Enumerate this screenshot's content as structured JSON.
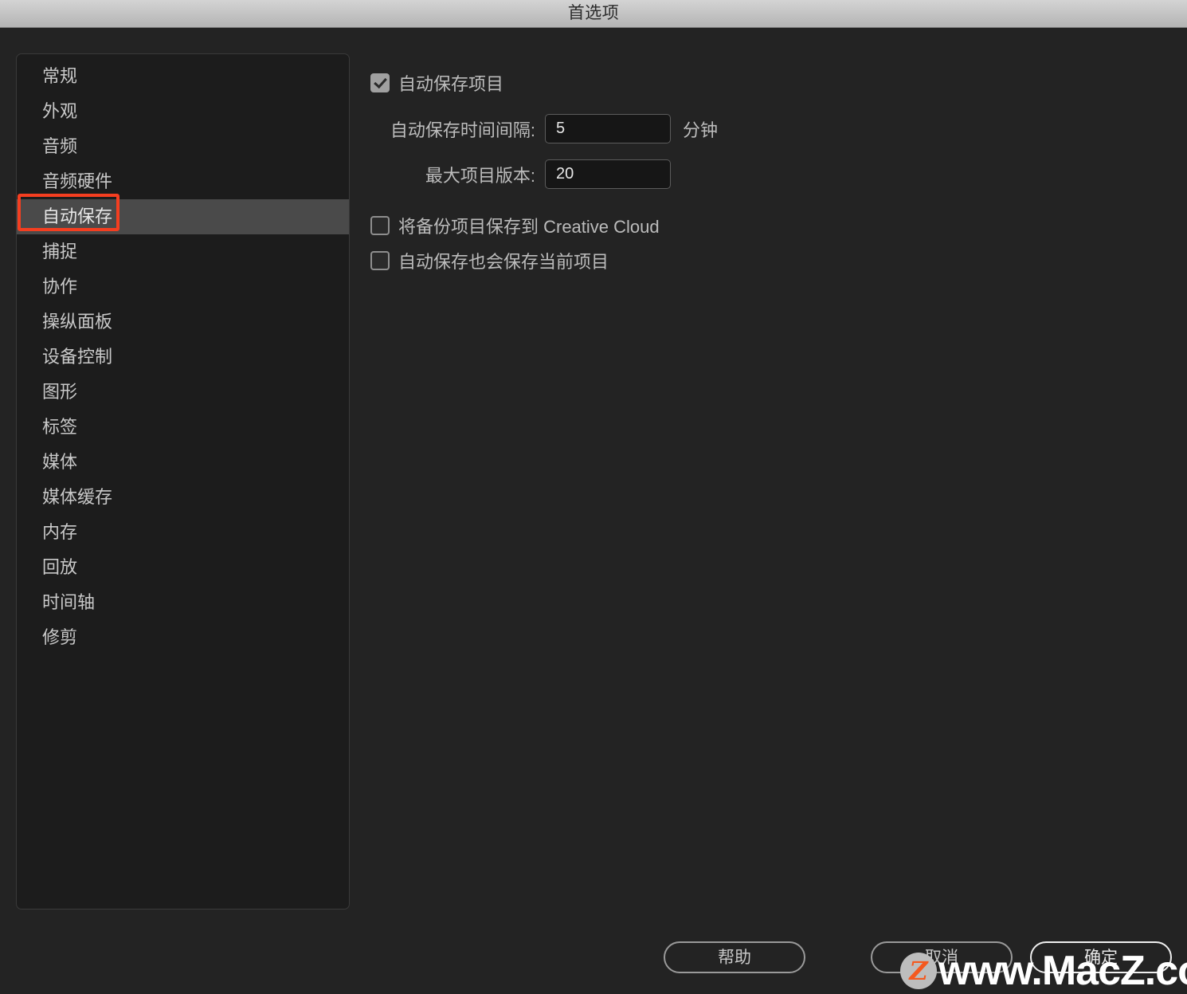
{
  "window": {
    "title": "首选项"
  },
  "sidebar": {
    "items": [
      {
        "label": "常规",
        "selected": false
      },
      {
        "label": "外观",
        "selected": false
      },
      {
        "label": "音频",
        "selected": false
      },
      {
        "label": "音频硬件",
        "selected": false
      },
      {
        "label": "自动保存",
        "selected": true
      },
      {
        "label": "捕捉",
        "selected": false
      },
      {
        "label": "协作",
        "selected": false
      },
      {
        "label": "操纵面板",
        "selected": false
      },
      {
        "label": "设备控制",
        "selected": false
      },
      {
        "label": "图形",
        "selected": false
      },
      {
        "label": "标签",
        "selected": false
      },
      {
        "label": "媒体",
        "selected": false
      },
      {
        "label": "媒体缓存",
        "selected": false
      },
      {
        "label": "内存",
        "selected": false
      },
      {
        "label": "回放",
        "selected": false
      },
      {
        "label": "时间轴",
        "selected": false
      },
      {
        "label": "修剪",
        "selected": false
      }
    ]
  },
  "panel": {
    "autosave_projects": {
      "label": "自动保存项目",
      "checked": true
    },
    "autosave_interval": {
      "label": "自动保存时间间隔:",
      "value": "5",
      "suffix": "分钟"
    },
    "max_versions": {
      "label": "最大项目版本:",
      "value": "20"
    },
    "backup_to_creative_cloud": {
      "label": "将备份项目保存到 Creative Cloud",
      "checked": false
    },
    "autosave_current_project": {
      "label": "自动保存也会保存当前项目",
      "checked": false
    }
  },
  "footer": {
    "help_label": "帮助",
    "cancel_label": "取消",
    "ok_label": "确定"
  },
  "annotation": {
    "color": "#f43e20",
    "target": "自动保存"
  },
  "watermark": {
    "logo_letter": "Z",
    "text": "www.MacZ.com",
    "logo_color": "#f4591f",
    "text_color": "#ffffff"
  }
}
